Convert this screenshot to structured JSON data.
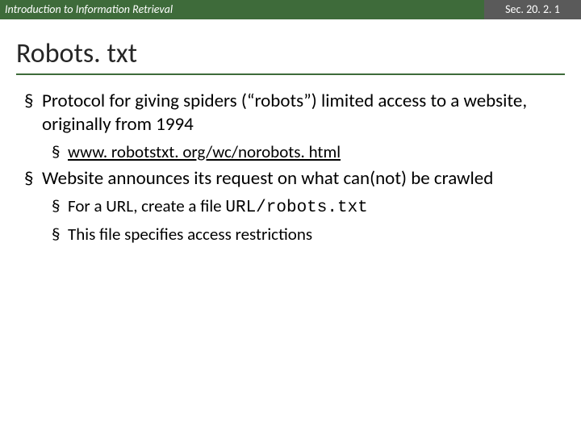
{
  "header": {
    "left": "Introduction to Information Retrieval",
    "right": "Sec. 20. 2. 1"
  },
  "title": "Robots. txt",
  "bullets": {
    "a": "Protocol for giving spiders (“robots”) limited access to a website, originally from 1994",
    "a_sub1": "www. robotstxt. org/wc/norobots. html",
    "b": "Website announces its request on what can(not) be crawled",
    "b_sub1_pre": "For a URL, create a file ",
    "b_sub1_mono": "URL/robots.txt",
    "b_sub2": "This file specifies access restrictions"
  },
  "square": "§"
}
